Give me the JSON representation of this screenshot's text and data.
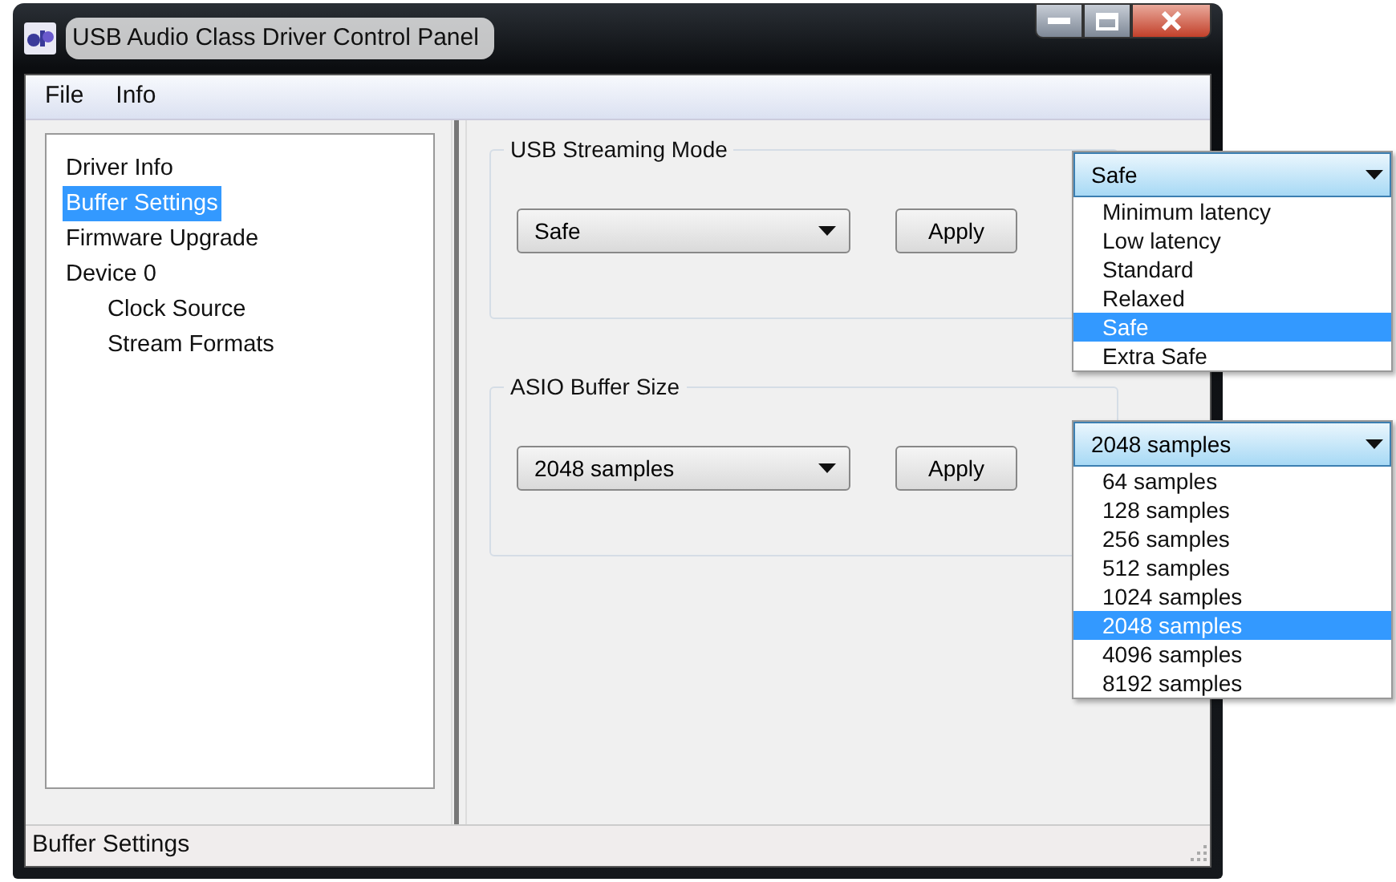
{
  "window": {
    "title": "USB Audio Class Driver Control Panel"
  },
  "menu": [
    "File",
    "Info"
  ],
  "tree": [
    {
      "label": "Driver Info",
      "selected": false
    },
    {
      "label": "Buffer Settings",
      "selected": true
    },
    {
      "label": "Firmware Upgrade",
      "selected": false
    },
    {
      "label": "Device 0",
      "selected": false,
      "children": [
        {
          "label": "Clock Source",
          "selected": false
        },
        {
          "label": "Stream Formats",
          "selected": false
        }
      ]
    }
  ],
  "groups": [
    {
      "title": "USB Streaming Mode",
      "value": "Safe",
      "button": "Apply",
      "dropdown": {
        "value": "Safe",
        "options": [
          {
            "label": "Minimum latency",
            "selected": false
          },
          {
            "label": "Low latency",
            "selected": false
          },
          {
            "label": "Standard",
            "selected": false
          },
          {
            "label": "Relaxed",
            "selected": false
          },
          {
            "label": "Safe",
            "selected": true
          },
          {
            "label": "Extra Safe",
            "selected": false
          }
        ]
      }
    },
    {
      "title": "ASIO Buffer Size",
      "value": "2048 samples",
      "button": "Apply",
      "dropdown": {
        "value": "2048 samples",
        "options": [
          {
            "label": "64 samples",
            "selected": false
          },
          {
            "label": "128 samples",
            "selected": false
          },
          {
            "label": "256 samples",
            "selected": false
          },
          {
            "label": "512 samples",
            "selected": false
          },
          {
            "label": "1024 samples",
            "selected": false
          },
          {
            "label": "2048 samples",
            "selected": true
          },
          {
            "label": "4096 samples",
            "selected": false
          },
          {
            "label": "8192 samples",
            "selected": false
          }
        ]
      }
    }
  ],
  "status_bar": "Buffer Settings"
}
